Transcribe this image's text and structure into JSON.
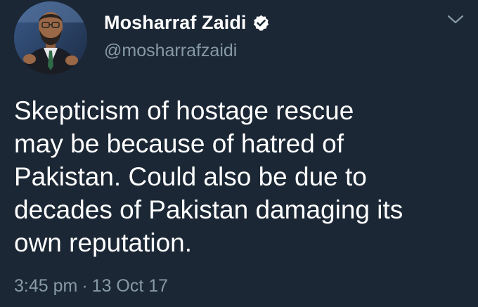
{
  "author": {
    "display_name": "Mosharraf Zaidi",
    "handle": "@mosharrafzaidi",
    "verified": true,
    "avatar_icon": "profile-photo"
  },
  "tweet": {
    "lines": [
      "Skepticism of hostage rescue",
      "may be because of hatred of",
      "Pakistan. Could also be due to",
      "decades of Pakistan damaging its",
      "own reputation."
    ],
    "time": "3:45 pm",
    "separator": "·",
    "date": "13 Oct 17"
  },
  "controls": {
    "menu_icon": "chevron-down-icon"
  },
  "colors": {
    "background": "#1b2735",
    "primary_text": "#ffffff",
    "secondary_text": "#8899a6"
  }
}
